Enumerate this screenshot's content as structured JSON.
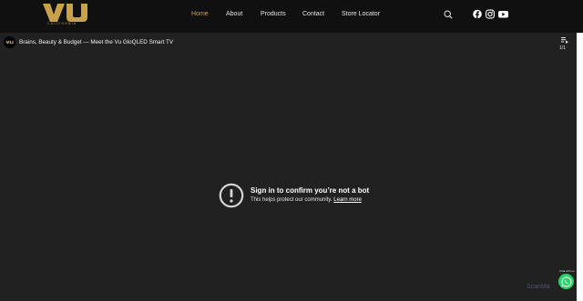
{
  "header": {
    "logo_text": "VU",
    "logo_tagline": "CALIFORNIA",
    "nav": [
      {
        "label": "Home",
        "active": true
      },
      {
        "label": "About"
      },
      {
        "label": "Products"
      },
      {
        "label": "Contact"
      },
      {
        "label": "Store Locator"
      }
    ],
    "icons": [
      "search-icon",
      "facebook-icon",
      "instagram-icon",
      "youtube-icon"
    ]
  },
  "video": {
    "channel_avatar_text": "VU",
    "title": "Brains, Beauty & Budget — Meet the Vu GloQLED Smart TV",
    "playlist_count": "1/1",
    "error_title": "Sign in to confirm you’re not a bot",
    "error_text": "This helps protect our community.",
    "error_link": "Learn more"
  },
  "widgets": {
    "watermark": "ScanMa",
    "whatsapp_label": "Chat with us"
  },
  "colors": {
    "accent": "#c8a24a",
    "header_bg": "#101010",
    "video_bg": "#212121",
    "whatsapp": "#25d366"
  }
}
